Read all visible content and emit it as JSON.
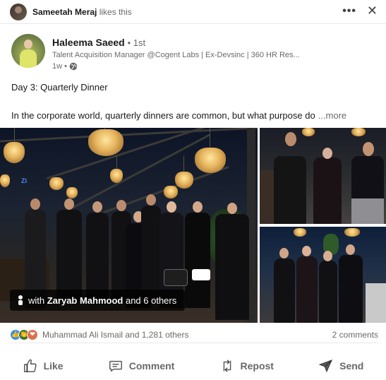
{
  "social_context": {
    "name": "Sameetah Meraj",
    "suffix": " likes this",
    "more_label": "•••",
    "close_label": "✕"
  },
  "actor": {
    "name": "Haleema Saeed",
    "degree": "• 1st",
    "headline": "Talent Acquisition Manager @Cogent Labs | Ex-Devsinc | 360 HR Res...",
    "time": "1w •",
    "visibility_icon": "globe-icon"
  },
  "post": {
    "line1": "Day 3: Quarterly Dinner",
    "line2": "In the corporate world, quarterly dinners are common, but what purpose do",
    "see_more": "...more"
  },
  "photos": {
    "tag_prefix": "with ",
    "tag_name": "Zaryab Mahmood",
    "tag_suffix": " and 6 others"
  },
  "social_counts": {
    "reactions_text": "Muhammad Ali Ismail and 1,281 others",
    "comments": "2 comments",
    "reaction_icons": [
      "like-icon",
      "celebrate-icon",
      "love-icon"
    ]
  },
  "actions": {
    "like": "Like",
    "comment": "Comment",
    "repost": "Repost",
    "send": "Send"
  },
  "colors": {
    "like_reaction": "#378fe9",
    "celebrate_reaction": "#44712e",
    "love_reaction": "#df704d"
  }
}
